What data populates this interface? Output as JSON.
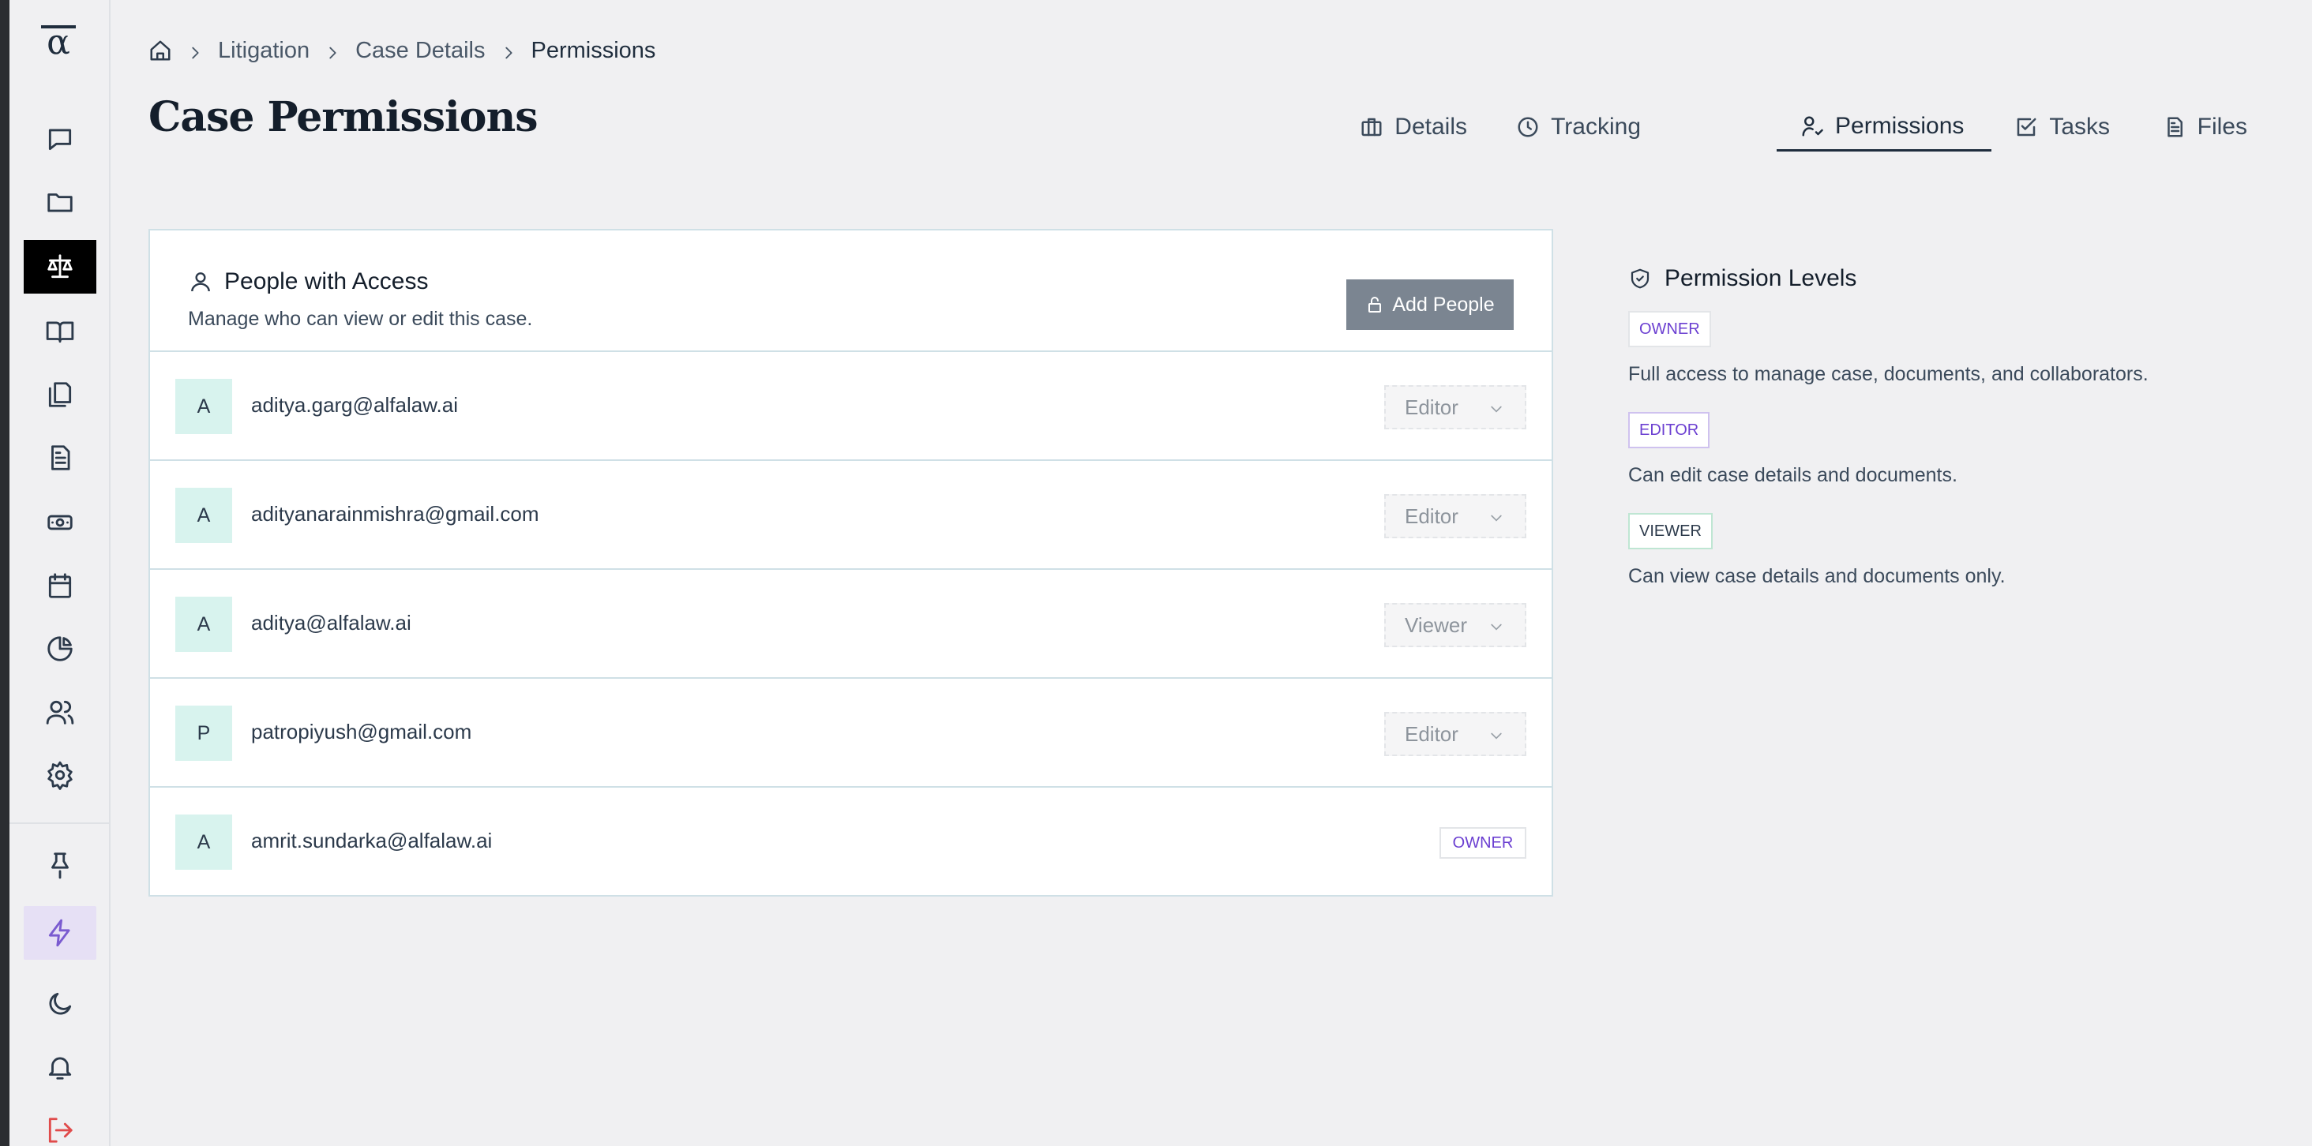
{
  "breadcrumb": {
    "items": [
      "Litigation",
      "Case Details",
      "Permissions"
    ]
  },
  "page": {
    "title": "Case Permissions"
  },
  "tabs": [
    {
      "label": "Details",
      "icon": "briefcase-icon"
    },
    {
      "label": "Tracking",
      "icon": "clock-icon"
    },
    {
      "label": "Permissions",
      "icon": "user-check-icon",
      "active": true
    },
    {
      "label": "Tasks",
      "icon": "check-square-icon"
    },
    {
      "label": "Files",
      "icon": "file-text-icon"
    }
  ],
  "access_card": {
    "title": "People with Access",
    "subtitle": "Manage who can view or edit this case.",
    "add_button_label": "Add People",
    "people": [
      {
        "initial": "A",
        "email": "aditya.garg@alfalaw.ai",
        "role": "Editor"
      },
      {
        "initial": "A",
        "email": "adityanarainmishra@gmail.com",
        "role": "Editor"
      },
      {
        "initial": "A",
        "email": "aditya@alfalaw.ai",
        "role": "Viewer"
      },
      {
        "initial": "P",
        "email": "patropiyush@gmail.com",
        "role": "Editor"
      },
      {
        "initial": "A",
        "email": "amrit.sundarka@alfalaw.ai",
        "role": "OWNER"
      }
    ]
  },
  "permission_levels": {
    "title": "Permission Levels",
    "levels": [
      {
        "badge": "OWNER",
        "description": "Full access to manage case, documents, and collaborators."
      },
      {
        "badge": "EDITOR",
        "description": "Can edit case details and documents."
      },
      {
        "badge": "VIEWER",
        "description": "Can view case details and documents only."
      }
    ]
  },
  "colors": {
    "accent_purple": "#6b3fd1",
    "avatar_bg": "#d8f3ee",
    "active_nav": "#000000",
    "logout_red": "#e04b4b"
  }
}
